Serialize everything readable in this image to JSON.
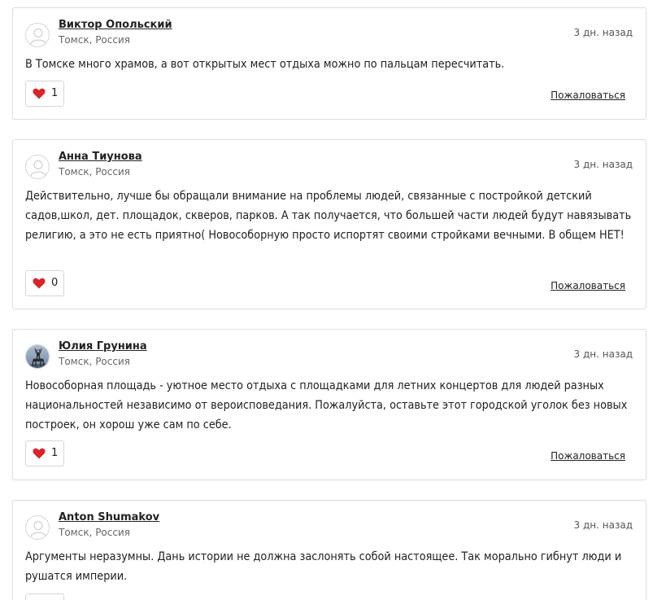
{
  "comments": [
    {
      "author": "Виктор Опольский",
      "location": "Томск, Россия",
      "date": "3 дн. назад",
      "text": "В Томске много храмов, а вот открытых мест отдыха можно по пальцам пересчитать.",
      "likes": "1",
      "report": "Пожаловаться",
      "avatar": "default-user-icon"
    },
    {
      "author": "Анна Тиунова",
      "location": "Томск, Россия",
      "date": "3 дн. назад",
      "text": "Действительно, лучше бы обращали внимание на проблемы людей, связанные с постройкой детский садов,школ, дет. площадок, скверов, парков. А так получается, что большей части людей будут навязывать религию, а это не есть приятно( Новособорную просто испортят своими стройками вечными. В общем НЕТ!",
      "likes": "0",
      "report": "Пожаловаться",
      "avatar": "default-user-icon"
    },
    {
      "author": "Юлия Грунина",
      "location": "Томск, Россия",
      "date": "3 дн. назад",
      "text": "Новособорная площадь - уютное место отдыха с площадками для летних концертов для людей разных национальностей независимо от вероисповедания. Пожалуйста, оставьте этот городской уголок без новых построек, он хорош уже сам по себе.",
      "likes": "1",
      "report": "Пожаловаться",
      "avatar": "deer-photo"
    },
    {
      "author": "Anton Shumakov",
      "location": "Томск, Россия",
      "date": "3 дн. назад",
      "text": "Аргументы неразумны. Дань истории не должна заслонять собой настоящее. Так морально гибнут люди и рушатся империи.",
      "avatar": "default-user-icon"
    }
  ],
  "colors": {
    "heart": "#d7262b",
    "border": "#dcdcdc",
    "text": "#222222",
    "muted": "#666666"
  }
}
